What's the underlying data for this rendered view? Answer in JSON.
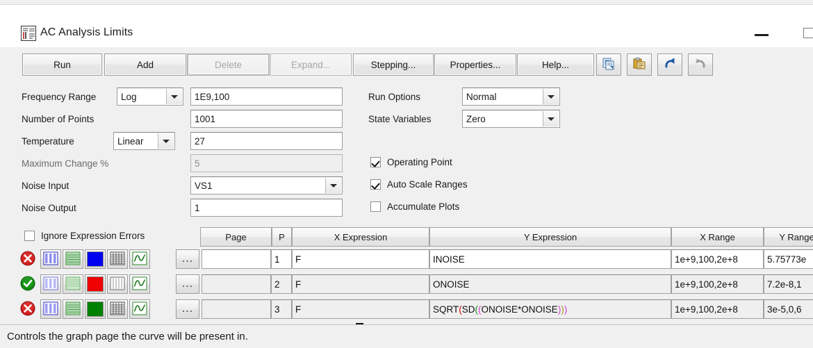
{
  "window": {
    "title": "AC Analysis Limits",
    "icon": "analysis-limits-icon",
    "minimize_label": "Minimize",
    "maximize_label": "Maximize"
  },
  "toolbar": {
    "buttons": [
      {
        "label": "Run",
        "name": "run-button",
        "disabled": false,
        "focused": false
      },
      {
        "label": "Add",
        "name": "add-button",
        "disabled": false,
        "focused": false
      },
      {
        "label": "Delete",
        "name": "delete-button",
        "disabled": true,
        "focused": true
      },
      {
        "label": "Expand...",
        "name": "expand-button",
        "disabled": true,
        "focused": false
      },
      {
        "label": "Stepping...",
        "name": "stepping-button",
        "disabled": false,
        "focused": false
      },
      {
        "label": "Properties...",
        "name": "properties-button",
        "disabled": false,
        "focused": false
      },
      {
        "label": "Help...",
        "name": "help-button",
        "disabled": false,
        "focused": false
      }
    ],
    "icon_buttons": [
      {
        "name": "copy-icon",
        "label": "Copy",
        "disabled": false
      },
      {
        "name": "paste-icon",
        "label": "Paste",
        "disabled": false
      },
      {
        "name": "undo-icon",
        "label": "Undo",
        "disabled": false
      },
      {
        "name": "redo-icon",
        "label": "Redo",
        "disabled": true
      }
    ]
  },
  "left_form": {
    "frequency_range": {
      "label": "Frequency Range",
      "scale_value": "Log",
      "value": "1E9,100"
    },
    "number_of_points": {
      "label": "Number of Points",
      "value": "1001"
    },
    "temperature": {
      "label": "Temperature",
      "scale_value": "Linear",
      "value": "27"
    },
    "maximum_change": {
      "label": "Maximum Change %",
      "value": "5",
      "readonly": true
    },
    "noise_input": {
      "label": "Noise Input",
      "value": "VS1"
    },
    "noise_output": {
      "label": "Noise Output",
      "value": "1"
    }
  },
  "right_form": {
    "run_options": {
      "label": "Run Options",
      "value": "Normal"
    },
    "state_variables": {
      "label": "State Variables",
      "value": "Zero"
    },
    "checkboxes": [
      {
        "label": "Operating Point",
        "checked": true,
        "name": "operating-point-checkbox"
      },
      {
        "label": "Auto Scale Ranges",
        "checked": true,
        "name": "auto-scale-ranges-checkbox"
      },
      {
        "label": "Accumulate Plots",
        "checked": false,
        "name": "accumulate-plots-checkbox"
      }
    ]
  },
  "table": {
    "ignore_errors": {
      "label": "Ignore Expression Errors",
      "checked": false
    },
    "headers": [
      "Page",
      "P",
      "X Expression",
      "Y Expression",
      "X Range",
      "Y Range"
    ],
    "ellipsis_label": "...",
    "rows": [
      {
        "enabled": false,
        "status_icon": "error-x-icon",
        "color": "#0000f0",
        "page": "",
        "p": "1",
        "x_expression": "F",
        "y_expression_plain": "INOISE",
        "x_range": "1e+9,100,2e+8",
        "y_range": "5.75773e",
        "active": true
      },
      {
        "enabled": true,
        "status_icon": "ok-check-icon",
        "color": "#f00000",
        "page": "",
        "p": "2",
        "x_expression": "F",
        "y_expression_plain": "ONOISE",
        "x_range": "1e+9,100,2e+8",
        "y_range": "7.2e-8,1",
        "active": false
      },
      {
        "enabled": false,
        "status_icon": "error-x-icon",
        "color": "#008000",
        "page": "",
        "p": "3",
        "x_expression": "F",
        "y_expression_plain": "SQRT(SD((ONOISE*ONOISE)))",
        "y_expression_tokens": [
          {
            "t": "SQRT",
            "c": "plain"
          },
          {
            "t": "(",
            "c": "red"
          },
          {
            "t": "SD",
            "c": "plain"
          },
          {
            "t": "(",
            "c": "green"
          },
          {
            "t": "(",
            "c": "magenta"
          },
          {
            "t": "ONOISE*ONOISE",
            "c": "plain"
          },
          {
            "t": ")",
            "c": "magenta"
          },
          {
            "t": ")",
            "c": "olive"
          },
          {
            "t": ")",
            "c": "magenta"
          }
        ],
        "x_range": "1e+9,100,2e+8",
        "y_range": "3e-5,0,6",
        "active": false
      }
    ],
    "row_icons": [
      "columns-icon",
      "stripes-icon",
      "color-swatch",
      "grid-icon",
      "waveform-icon"
    ]
  },
  "status_bar": {
    "text": "Controls the graph page the curve will be present in."
  },
  "colors": {
    "face": "#f0f0f0",
    "field": "#ffffff",
    "border": "#9f9f9f",
    "text": "#1a1a1a",
    "disabled_text": "#a6a6a6"
  }
}
